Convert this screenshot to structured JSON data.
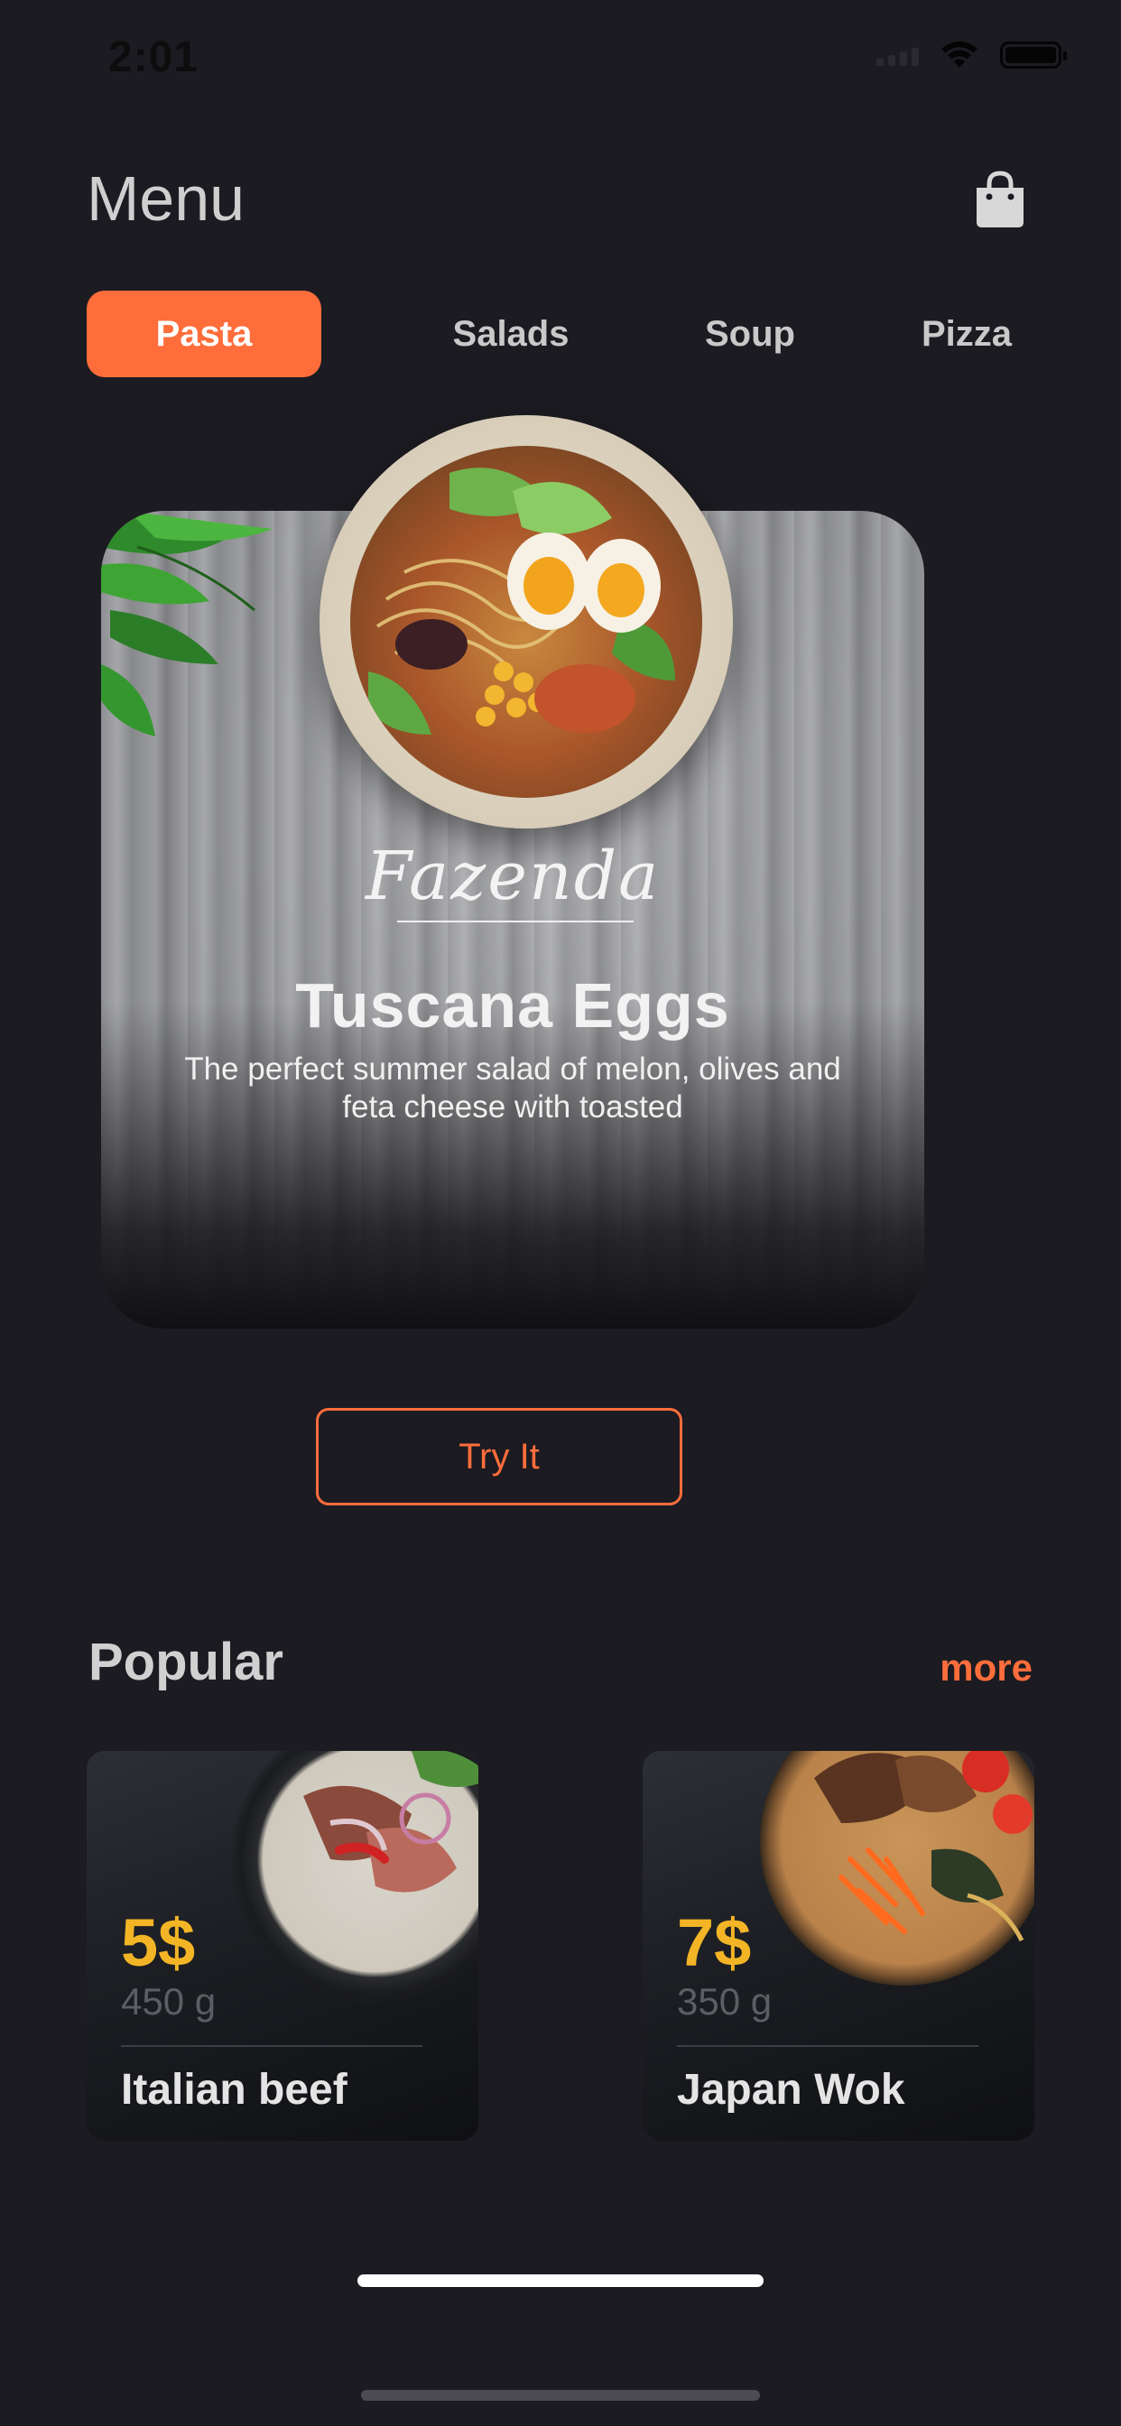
{
  "status_bar": {
    "time": "2:01"
  },
  "header": {
    "title": "Menu",
    "cart_icon": "shopping-bag-icon"
  },
  "tabs": [
    {
      "label": "Pasta",
      "active": true
    },
    {
      "label": "Salads",
      "active": false
    },
    {
      "label": "Soup",
      "active": false
    },
    {
      "label": "Pizza",
      "active": false
    }
  ],
  "featured": {
    "brand": "Fazenda",
    "title": "Tuscana Eggs",
    "description": "The perfect summer salad of melon, olives and feta cheese with toasted",
    "button_label": "Try It"
  },
  "popular": {
    "title": "Popular",
    "more_label": "more",
    "items": [
      {
        "price": "5$",
        "weight": "450 g",
        "name": "Italian beef"
      },
      {
        "price": "7$",
        "weight": "350 g",
        "name": "Japan Wok"
      }
    ]
  },
  "colors": {
    "background": "#1b1b21",
    "accent": "#ff6d3b",
    "price": "#f3b526"
  }
}
